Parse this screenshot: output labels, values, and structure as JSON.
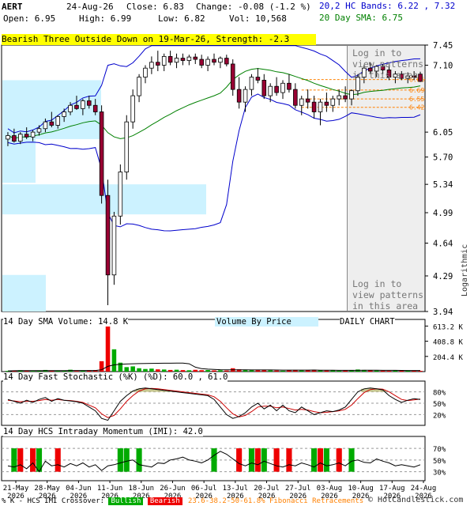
{
  "header": {
    "symbol": "AERT",
    "date": "24-Aug-26",
    "close": "Close: 6.83",
    "change": "Change: -0.08 (-1.2 %)",
    "open": "Open: 6.95",
    "high": "High: 6.99",
    "low": "Low: 6.82",
    "vol": "Vol: 10,568",
    "bands": "20,2 HC Bands: 6.22 , 7.32",
    "sma": "20 Day SMA: 6.75"
  },
  "pattern_banner": "Bearish Three Outside Down on 19-Mar-26, Strength: -2.3",
  "login_text": [
    "Log in to",
    "view patterns",
    "in this area"
  ],
  "panels": {
    "volume_label": "14 Day SMA Volume: 14.8 K",
    "vbp_label": "Volume By Price",
    "daily_label": "DAILY CHART",
    "stoch_label": "14 Day Fast Stochastic (%K) (%D): 60.0 , 61.0",
    "imi_label": "14 Day HCS Intraday Momentum (IMI): 42.0"
  },
  "footer": {
    "imi_text": "% K - HCS IMI Crossover:",
    "bullish": "Bullish",
    "bearish": "Bearish",
    "fib": "23.6-38.2-50-61.8% Fibonacci Retracements",
    "copyright": "© HotCandlestick.com",
    "log_label": "Logarithmic"
  },
  "colors": {
    "bull": "#00aa00",
    "bear": "#ee0000",
    "candle_bear": "#990033",
    "band": "#0000cc",
    "sma": "#008000",
    "fib": "#ff8000",
    "vbp": "#ccf2ff"
  },
  "chart_data": {
    "type": "candlestick",
    "scale": "log",
    "price_axis_ticks": [
      "7.45",
      "7.10",
      "6.05",
      "5.70",
      "5.34",
      "4.99",
      "4.64",
      "4.29",
      "3.94"
    ],
    "price_range": [
      3.94,
      7.45
    ],
    "fib_levels": [
      "6.86",
      "6.69",
      "6.55",
      "6.42"
    ],
    "volume_axis_ticks": [
      "613.2 K",
      "408.8 K",
      "204.4 K"
    ],
    "stoch_axis_ticks": [
      "80%",
      "50%",
      "20%"
    ],
    "imi_axis_ticks": [
      "70%",
      "50%",
      "30%"
    ],
    "x_labels": [
      [
        "21-May",
        "2026"
      ],
      [
        "28-May",
        "2026"
      ],
      [
        "04-Jun",
        "2026"
      ],
      [
        "11-Jun",
        "2026"
      ],
      [
        "18-Jun",
        "2026"
      ],
      [
        "26-Jun",
        "2026"
      ],
      [
        "06-Jul",
        "2026"
      ],
      [
        "13-Jul",
        "2026"
      ],
      [
        "20-Jul",
        "2026"
      ],
      [
        "27-Jul",
        "2026"
      ],
      [
        "03-Aug",
        "2026"
      ],
      [
        "10-Aug",
        "2026"
      ],
      [
        "17-Aug",
        "2026"
      ],
      [
        "24-Aug",
        "2026"
      ]
    ],
    "candles": [
      [
        5.95,
        6.05,
        5.85,
        6.0
      ],
      [
        6.0,
        6.1,
        5.9,
        5.92
      ],
      [
        5.92,
        6.05,
        5.88,
        6.02
      ],
      [
        6.02,
        6.12,
        5.95,
        5.98
      ],
      [
        5.98,
        6.08,
        5.92,
        6.05
      ],
      [
        6.05,
        6.15,
        6.0,
        6.1
      ],
      [
        6.1,
        6.25,
        6.05,
        6.2
      ],
      [
        6.2,
        6.35,
        6.12,
        6.15
      ],
      [
        6.15,
        6.3,
        6.1,
        6.28
      ],
      [
        6.28,
        6.4,
        6.2,
        6.35
      ],
      [
        6.35,
        6.5,
        6.3,
        6.45
      ],
      [
        6.45,
        6.6,
        6.38,
        6.4
      ],
      [
        6.4,
        6.55,
        6.3,
        6.52
      ],
      [
        6.52,
        6.6,
        6.4,
        6.45
      ],
      [
        6.45,
        6.55,
        6.3,
        6.35
      ],
      [
        6.35,
        6.45,
        5.1,
        5.2
      ],
      [
        5.2,
        5.4,
        4.0,
        4.3
      ],
      [
        4.3,
        5.0,
        4.2,
        4.95
      ],
      [
        4.95,
        5.6,
        4.85,
        5.5
      ],
      [
        5.5,
        6.3,
        5.4,
        6.2
      ],
      [
        6.2,
        6.7,
        6.1,
        6.6
      ],
      [
        6.6,
        6.95,
        6.5,
        6.9
      ],
      [
        6.9,
        7.1,
        6.8,
        7.05
      ],
      [
        7.05,
        7.25,
        6.95,
        7.15
      ],
      [
        7.15,
        7.35,
        7.0,
        7.1
      ],
      [
        7.1,
        7.3,
        7.0,
        7.25
      ],
      [
        7.25,
        7.35,
        7.1,
        7.15
      ],
      [
        7.15,
        7.3,
        7.05,
        7.22
      ],
      [
        7.22,
        7.3,
        7.1,
        7.18
      ],
      [
        7.18,
        7.28,
        7.1,
        7.24
      ],
      [
        7.24,
        7.3,
        7.12,
        7.2
      ],
      [
        7.2,
        7.28,
        7.05,
        7.1
      ],
      [
        7.1,
        7.25,
        7.0,
        7.2
      ],
      [
        7.2,
        7.3,
        7.1,
        7.15
      ],
      [
        7.15,
        7.25,
        7.05,
        7.22
      ],
      [
        7.22,
        7.28,
        7.08,
        7.12
      ],
      [
        7.12,
        7.2,
        6.6,
        6.7
      ],
      [
        6.7,
        6.9,
        6.4,
        6.5
      ],
      [
        6.5,
        6.75,
        6.35,
        6.7
      ],
      [
        6.7,
        6.95,
        6.6,
        6.9
      ],
      [
        6.9,
        7.05,
        6.8,
        6.85
      ],
      [
        6.85,
        6.95,
        6.55,
        6.6
      ],
      [
        6.6,
        6.8,
        6.5,
        6.75
      ],
      [
        6.75,
        6.9,
        6.6,
        6.65
      ],
      [
        6.65,
        6.85,
        6.55,
        6.8
      ],
      [
        6.8,
        6.95,
        6.65,
        6.7
      ],
      [
        6.7,
        6.8,
        6.4,
        6.45
      ],
      [
        6.45,
        6.6,
        6.3,
        6.55
      ],
      [
        6.55,
        6.7,
        6.4,
        6.5
      ],
      [
        6.5,
        6.6,
        6.25,
        6.35
      ],
      [
        6.35,
        6.55,
        6.15,
        6.5
      ],
      [
        6.5,
        6.65,
        6.35,
        6.45
      ],
      [
        6.45,
        6.6,
        6.35,
        6.55
      ],
      [
        6.55,
        6.7,
        6.45,
        6.6
      ],
      [
        6.6,
        6.75,
        6.5,
        6.55
      ],
      [
        6.55,
        6.7,
        6.45,
        6.68
      ],
      [
        6.68,
        6.95,
        6.6,
        6.9
      ],
      [
        6.9,
        7.1,
        6.8,
        7.05
      ],
      [
        7.05,
        7.15,
        6.95,
        7.0
      ],
      [
        7.0,
        7.1,
        6.9,
        7.08
      ],
      [
        7.08,
        7.12,
        6.95,
        7.02
      ],
      [
        7.02,
        7.1,
        6.85,
        6.9
      ],
      [
        6.9,
        7.0,
        6.8,
        6.95
      ],
      [
        6.95,
        7.0,
        6.85,
        6.88
      ],
      [
        6.88,
        6.98,
        6.8,
        6.92
      ],
      [
        6.92,
        7.0,
        6.85,
        6.9
      ],
      [
        6.95,
        6.99,
        6.82,
        6.83
      ]
    ],
    "volume": [
      10,
      14,
      18,
      12,
      9,
      15,
      22,
      11,
      16,
      13,
      25,
      9,
      14,
      17,
      20,
      140,
      660,
      300,
      120,
      60,
      70,
      45,
      35,
      40,
      30,
      28,
      22,
      25,
      20,
      18,
      24,
      19,
      21,
      16,
      18,
      14,
      45,
      30,
      22,
      20,
      18,
      25,
      16,
      14,
      12,
      18,
      22,
      15,
      17,
      24,
      19,
      14,
      16,
      12,
      15,
      18,
      28,
      22,
      16,
      14,
      12,
      10,
      15,
      12,
      11,
      13,
      10
    ],
    "stoch_k": [
      60,
      55,
      50,
      58,
      52,
      60,
      65,
      55,
      62,
      58,
      56,
      54,
      50,
      40,
      30,
      10,
      5,
      30,
      55,
      70,
      82,
      88,
      90,
      88,
      86,
      84,
      82,
      80,
      78,
      76,
      74,
      72,
      70,
      60,
      40,
      20,
      10,
      15,
      25,
      40,
      50,
      35,
      45,
      30,
      45,
      30,
      25,
      40,
      30,
      20,
      25,
      30,
      28,
      32,
      40,
      60,
      80,
      88,
      90,
      88,
      85,
      70,
      60,
      52,
      58,
      62,
      60
    ],
    "stoch_d": [
      58,
      56,
      54,
      55,
      55,
      57,
      60,
      58,
      60,
      58,
      57,
      55,
      52,
      45,
      38,
      22,
      12,
      18,
      35,
      55,
      70,
      82,
      88,
      89,
      88,
      86,
      84,
      82,
      80,
      78,
      76,
      74,
      72,
      67,
      55,
      38,
      22,
      14,
      18,
      28,
      40,
      42,
      42,
      38,
      40,
      36,
      32,
      34,
      32,
      28,
      25,
      26,
      28,
      30,
      34,
      45,
      62,
      78,
      86,
      88,
      87,
      80,
      70,
      60,
      57,
      59,
      61
    ],
    "imi": [
      40,
      38,
      42,
      35,
      45,
      30,
      48,
      40,
      42,
      38,
      44,
      40,
      45,
      38,
      42,
      32,
      40,
      42,
      45,
      48,
      50,
      42,
      40,
      38,
      45,
      44,
      50,
      52,
      55,
      50,
      48,
      45,
      50,
      58,
      65,
      60,
      52,
      44,
      40,
      45,
      42,
      48,
      44,
      40,
      38,
      42,
      40,
      45,
      42,
      38,
      45,
      40,
      42,
      45,
      40,
      48,
      50,
      46,
      45,
      52,
      48,
      45,
      40,
      42,
      40,
      38,
      42
    ],
    "imi_signals": [
      [
        1,
        "bull"
      ],
      [
        2,
        "bear"
      ],
      [
        4,
        "bear"
      ],
      [
        5,
        "bull"
      ],
      [
        8,
        "bear"
      ],
      [
        18,
        "bull"
      ],
      [
        19,
        "bull"
      ],
      [
        21,
        "bull"
      ],
      [
        33,
        "bull"
      ],
      [
        37,
        "bear"
      ],
      [
        39,
        "bull"
      ],
      [
        40,
        "bear"
      ],
      [
        41,
        "bull"
      ],
      [
        43,
        "bear"
      ],
      [
        45,
        "bear"
      ],
      [
        49,
        "bull"
      ],
      [
        50,
        "bear"
      ],
      [
        51,
        "bull"
      ],
      [
        53,
        "bear"
      ],
      [
        55,
        "bull"
      ]
    ]
  }
}
